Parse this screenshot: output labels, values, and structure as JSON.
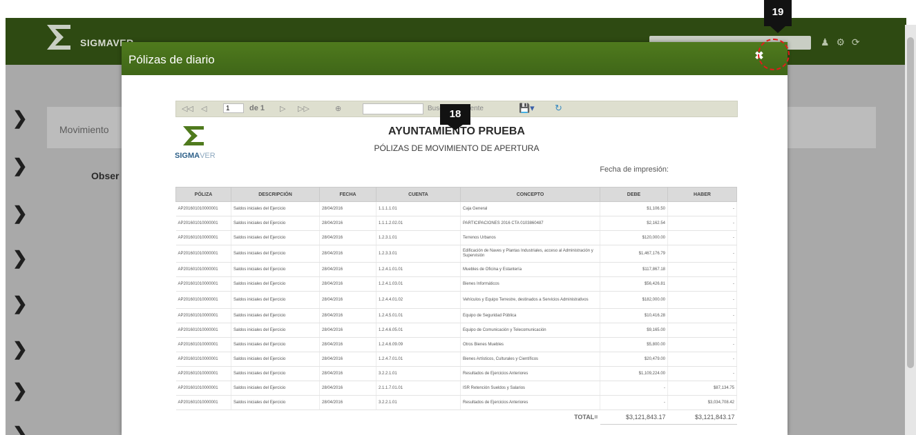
{
  "app": {
    "logo_text": "SIGMAVER",
    "background_label": "Movimiento",
    "background_field": "Obser"
  },
  "modal": {
    "title": "Pólizas de diario",
    "close_icon": "close-icon"
  },
  "callouts": {
    "close": "19",
    "report": "18"
  },
  "viewer_toolbar": {
    "first": "◁◁",
    "prev": "◁",
    "page_value": "1",
    "of_label": "de 1",
    "next": "▷",
    "last": "▷▷",
    "find_placeholder": "",
    "find_label": "Buscar | Siguiente",
    "save_icon": "save-icon",
    "refresh_icon": "refresh-icon"
  },
  "report": {
    "logo_text_bold": "SIGMA",
    "logo_text_light": "VER",
    "title": "AYUNTAMIENTO PRUEBA",
    "subtitle": "PÓLIZAS DE MOVIMIENTO DE APERTURA",
    "print_date_label": "Fecha de impresión:",
    "columns": [
      "PÓLIZA",
      "DESCRIPCIÓN",
      "FECHA",
      "CUENTA",
      "CONCEPTO",
      "DEBE",
      "HABER"
    ],
    "rows": [
      {
        "poliza": "AP201601010000001",
        "descripcion": "Saldos iniciales del Ejercicio",
        "fecha": "28/04/2016",
        "cuenta": "1.1.1.1.01",
        "concepto": "Caja General",
        "debe": "$1,106.50",
        "haber": "-"
      },
      {
        "poliza": "AP201601010000001",
        "descripcion": "Saldos iniciales del Ejercicio",
        "fecha": "28/04/2016",
        "cuenta": "1.1.1.2.02.01",
        "concepto": "PARTICIPACIONES 2016 CTA 0103860487",
        "debe": "$2,162.54",
        "haber": "-"
      },
      {
        "poliza": "AP201601010000001",
        "descripcion": "Saldos iniciales del Ejercicio",
        "fecha": "28/04/2016",
        "cuenta": "1.2.3.1.01",
        "concepto": "Terrenos Urbanos",
        "debe": "$120,000.00",
        "haber": "-"
      },
      {
        "poliza": "AP201601010000001",
        "descripcion": "Saldos iniciales del Ejercicio",
        "fecha": "28/04/2016",
        "cuenta": "1.2.3.3.01",
        "concepto": "Edificación de Naves y Plantas Industriales, acceso al Administración y Supervisión",
        "debe": "$1,467,176.79",
        "haber": "-",
        "tall": true
      },
      {
        "poliza": "AP201601010000001",
        "descripcion": "Saldos iniciales del Ejercicio",
        "fecha": "28/04/2016",
        "cuenta": "1.2.4.1.01.01",
        "concepto": "Muebles de Oficina y Estantería",
        "debe": "$117,867.18",
        "haber": "-"
      },
      {
        "poliza": "AP201601010000001",
        "descripcion": "Saldos iniciales del Ejercicio",
        "fecha": "28/04/2016",
        "cuenta": "1.2.4.1.03.01",
        "concepto": "Bienes Informáticos",
        "debe": "$56,426.81",
        "haber": "-"
      },
      {
        "poliza": "AP201601010000001",
        "descripcion": "Saldos iniciales del Ejercicio",
        "fecha": "28/04/2016",
        "cuenta": "1.2.4.4.01.02",
        "concepto": "Vehículos y Equipo Terrestre, destinados a Servicios Administrativos",
        "debe": "$182,000.00",
        "haber": "-",
        "tall": true
      },
      {
        "poliza": "AP201601010000001",
        "descripcion": "Saldos iniciales del Ejercicio",
        "fecha": "28/04/2016",
        "cuenta": "1.2.4.5.01.01",
        "concepto": "Equipo de Seguridad Pública",
        "debe": "$10,416.28",
        "haber": "-"
      },
      {
        "poliza": "AP201601010000001",
        "descripcion": "Saldos iniciales del Ejercicio",
        "fecha": "28/04/2016",
        "cuenta": "1.2.4.6.05.01",
        "concepto": "Equipo de Comunicación y Telecomunicación",
        "debe": "$9,165.00",
        "haber": "-"
      },
      {
        "poliza": "AP201601010000001",
        "descripcion": "Saldos iniciales del Ejercicio",
        "fecha": "28/04/2016",
        "cuenta": "1.2.4.6.09.09",
        "concepto": "Otros Bienes Muebles",
        "debe": "$5,800.00",
        "haber": "-"
      },
      {
        "poliza": "AP201601010000001",
        "descripcion": "Saldos iniciales del Ejercicio",
        "fecha": "28/04/2016",
        "cuenta": "1.2.4.7.01.01",
        "concepto": "Bienes Artísticos, Culturales y Científicos",
        "debe": "$20,479.00",
        "haber": "-"
      },
      {
        "poliza": "AP201601010000001",
        "descripcion": "Saldos iniciales del Ejercicio",
        "fecha": "28/04/2016",
        "cuenta": "3.2.2.1.01",
        "concepto": "Resultados de Ejercicios Anteriores",
        "debe": "$1,109,224.00",
        "haber": "-"
      },
      {
        "poliza": "AP201601010000001",
        "descripcion": "Saldos iniciales del Ejercicio",
        "fecha": "28/04/2016",
        "cuenta": "2.1.1.7.01.01",
        "concepto": "ISR Retención Sueldos y Salarios",
        "debe": "-",
        "haber": "$87,134.75"
      },
      {
        "poliza": "AP201601010000001",
        "descripcion": "Saldos iniciales del Ejercicio",
        "fecha": "28/04/2016",
        "cuenta": "3.2.2.1.01",
        "concepto": "Resultados de Ejercicios Anteriores",
        "debe": "-",
        "haber": "$3,034,708.42"
      }
    ],
    "total_label": "TOTAL=",
    "total_debe": "$3,121,843.17",
    "total_haber": "$3,121,843.17"
  }
}
